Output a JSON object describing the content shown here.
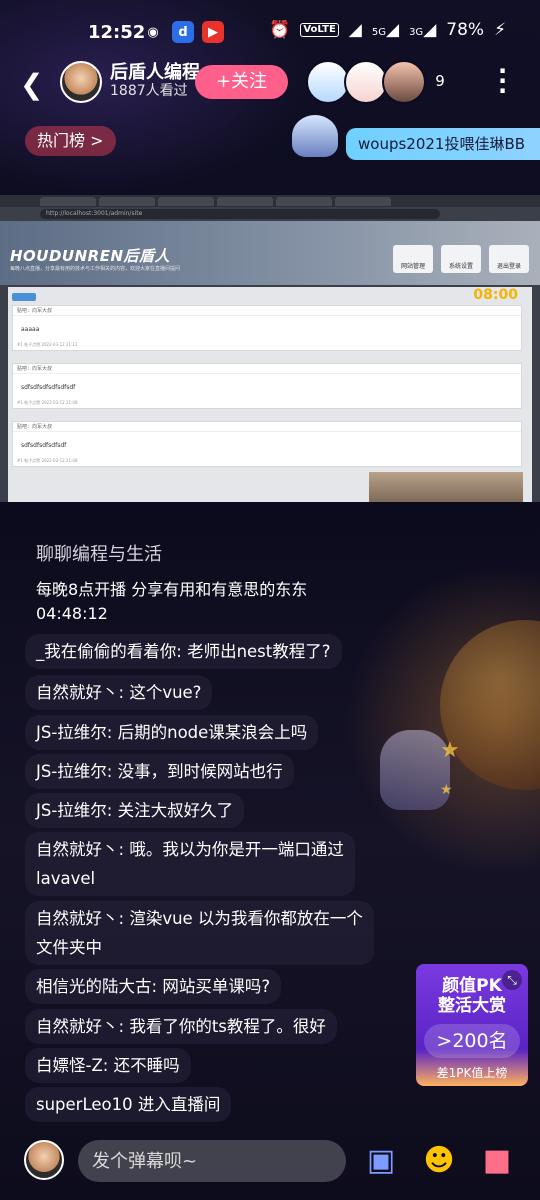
{
  "status_bar": {
    "time": "12:52",
    "signal_5g": "5G",
    "signal_3g": "3G",
    "volte": "VoLTE",
    "battery": "78%"
  },
  "header": {
    "host_name": "后盾人编程",
    "host_views": "1887人看过",
    "follow_label": "+关注",
    "viewer_count": "9"
  },
  "hot_list": {
    "label": "热门榜 >"
  },
  "gift_banner": {
    "text": "woups2021投喂佳琳BB"
  },
  "stream": {
    "url": "http://localhost:3001/admin/site",
    "site_logo": "HOUDUNREN后盾人",
    "site_sub": "每晚八点直播，分享最有用的技术与工作相关的内容，欢迎大家在直播间提问",
    "nav": [
      "网站管理",
      "系统设置",
      "退出登录"
    ],
    "clock": "08:00",
    "cards": [
      {
        "bar": "贴吧：向军大叔",
        "body": "aaaaa",
        "foot": "#1 帖子点赞 2022-03-12 21:12"
      },
      {
        "bar": "贴吧：向军大叔",
        "body": "sdfsdfsdfsdfsdfsdf",
        "foot": "#1 帖子点赞 2022-03-12 21:08"
      },
      {
        "bar": "贴吧：向军大叔",
        "body": "sdfsdfsdfsdfsdf",
        "foot": "#1 帖子点赞 2022-03-12 21:08"
      }
    ]
  },
  "chat": {
    "title": "聊聊编程与生活",
    "intro": "每晚8点开播 分享有用和有意思的东东",
    "intro_time": "04:48:12",
    "messages": [
      {
        "user": "_我在偷偷的看着你",
        "text": "老师出nest教程了?"
      },
      {
        "user": "自然就好丶",
        "text": "这个vue?"
      },
      {
        "user": "JS-拉维尔",
        "text": "后期的node课某浪会上吗"
      },
      {
        "user": "JS-拉维尔",
        "text": "没事，到时候网站也行"
      },
      {
        "user": "JS-拉维尔",
        "text": "关注大叔好久了"
      },
      {
        "user": "自然就好丶",
        "text": "哦。我以为你是开一端口通过",
        "text2": "lavavel"
      },
      {
        "user": "自然就好丶",
        "text": "渲染vue 以为我看你都放在一个",
        "text2": "文件夹中"
      },
      {
        "user": "相信光的陆大古",
        "text": "网站买单课吗?"
      },
      {
        "user": "自然就好丶",
        "text": "我看了你的ts教程了。很好"
      },
      {
        "user": "白嫖怪-Z",
        "text": "还不睡吗"
      },
      {
        "user": "superLeo10",
        "text": "进入直播间"
      }
    ]
  },
  "pk_banner": {
    "title1": "颜值PK",
    "title2": "整活大赏",
    "rank": ">200名",
    "sub": "差1PK值上榜"
  },
  "bottom": {
    "input_placeholder": "发个弹幕呗~"
  },
  "icons": {
    "back": "chevron-left-icon",
    "more": "more-vertical-icon",
    "bot": "robot-icon",
    "emoji": "sunglasses-emoji-icon",
    "gift": "gift-icon"
  }
}
